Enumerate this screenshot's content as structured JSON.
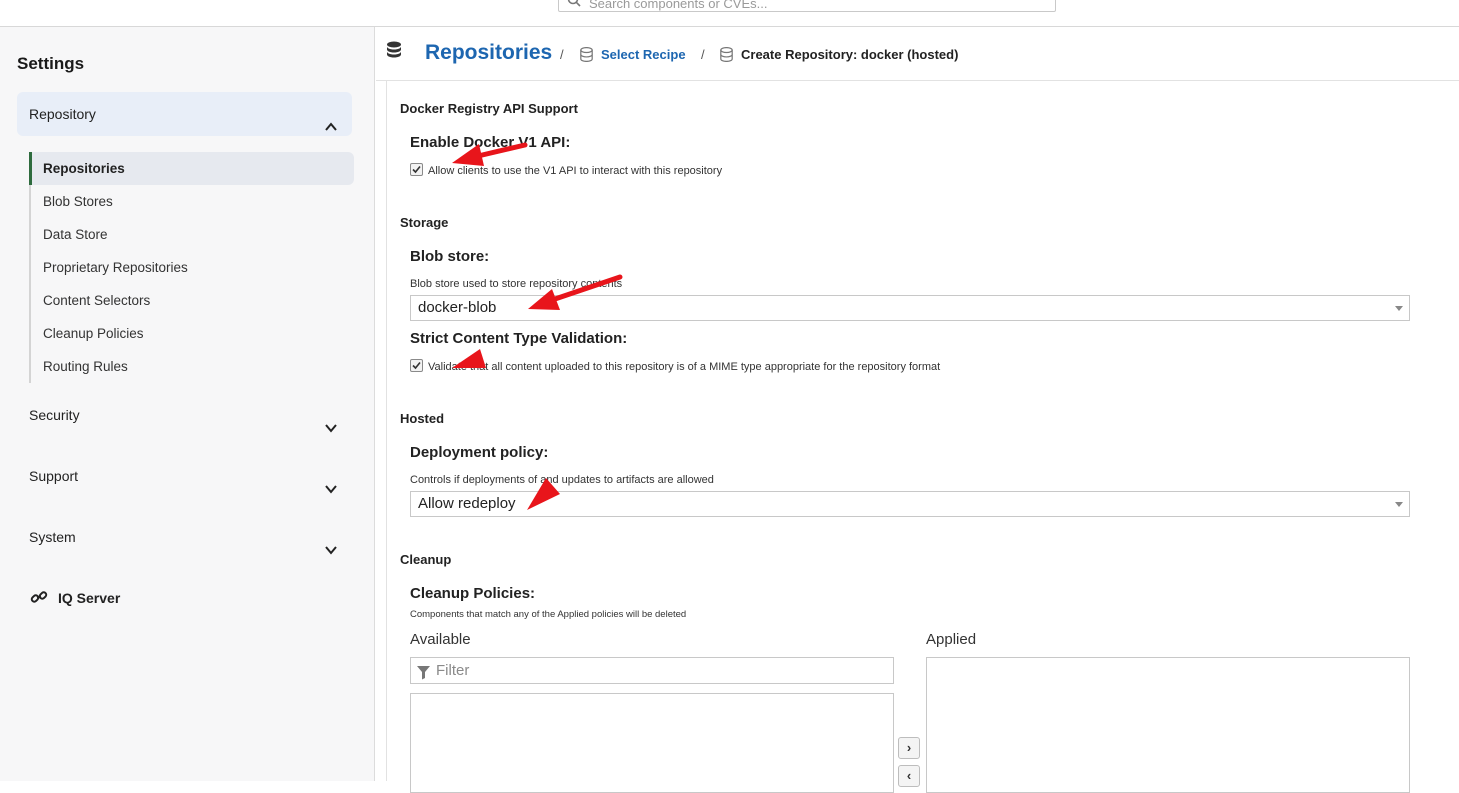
{
  "topbar": {
    "search_placeholder": "Search components or CVEs..."
  },
  "sidebar": {
    "title": "Settings",
    "sections": {
      "repository": "Repository",
      "security": "Security",
      "support": "Support",
      "system": "System"
    },
    "items": [
      {
        "label": "Repositories",
        "active": true
      },
      {
        "label": "Blob Stores"
      },
      {
        "label": "Data Store"
      },
      {
        "label": "Proprietary Repositories"
      },
      {
        "label": "Content Selectors"
      },
      {
        "label": "Cleanup Policies"
      },
      {
        "label": "Routing Rules"
      }
    ],
    "iq_server": "IQ Server"
  },
  "breadcrumb": {
    "title": "Repositories",
    "sep": "/",
    "recipe": "Select Recipe",
    "current": "Create Repository: docker (hosted)"
  },
  "form": {
    "docker_api": {
      "section": "Docker Registry API Support",
      "label": "Enable Docker V1 API:",
      "checkbox_text": "Allow clients to use the V1 API to interact with this repository",
      "checked": true
    },
    "storage": {
      "section": "Storage",
      "blob_label": "Blob store:",
      "blob_help": "Blob store used to store repository contents",
      "blob_value": "docker-blob",
      "strict_label": "Strict Content Type Validation:",
      "strict_text": "Validate that all content uploaded to this repository is of a MIME type appropriate for the repository format",
      "strict_checked": true
    },
    "hosted": {
      "section": "Hosted",
      "deploy_label": "Deployment policy:",
      "deploy_help": "Controls if deployments of and updates to artifacts are allowed",
      "deploy_value": "Allow redeploy"
    },
    "cleanup": {
      "section": "Cleanup",
      "label": "Cleanup Policies:",
      "help": "Components that match any of the Applied policies will be deleted",
      "available": "Available",
      "applied": "Applied",
      "filter_placeholder": "Filter",
      "move_right": "›",
      "move_left": "‹"
    }
  },
  "colors": {
    "accent": "#1d66b0",
    "annotation": "#e8151b",
    "active_bar": "#2e6b3e"
  }
}
